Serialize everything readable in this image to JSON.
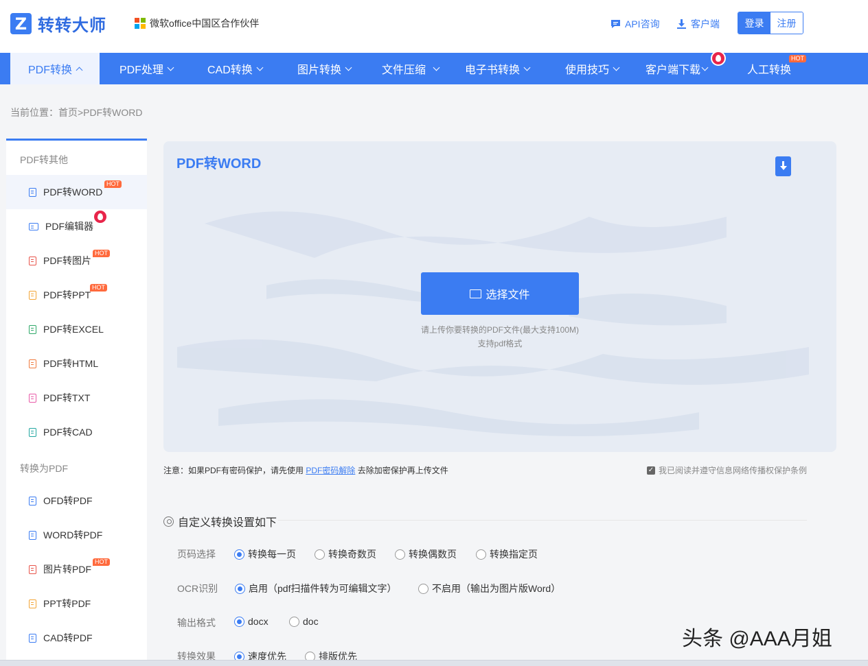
{
  "header": {
    "logo_mark": "Z",
    "logo_text": "转转大师",
    "partner": "微软office中国区合作伙伴",
    "api_link": "API咨询",
    "client_link": "客户端",
    "login": "登录",
    "register": "注册"
  },
  "nav": {
    "items": [
      {
        "label": "PDF转换"
      },
      {
        "label": "PDF处理"
      },
      {
        "label": "CAD转换"
      },
      {
        "label": "图片转换"
      },
      {
        "label": "文件压缩"
      },
      {
        "label": "电子书转换"
      },
      {
        "label": "使用技巧"
      },
      {
        "label": "客户端下载"
      },
      {
        "label": "人工转换"
      }
    ],
    "hot_badge": "HOT"
  },
  "breadcrumb": "当前位置：首页>PDF转WORD",
  "sidebar": {
    "group1": "PDF转其他",
    "group1_items": [
      {
        "label": "PDF转WORD"
      },
      {
        "label": "PDF编辑器"
      },
      {
        "label": "PDF转图片"
      },
      {
        "label": "PDF转PPT"
      },
      {
        "label": "PDF转EXCEL"
      },
      {
        "label": "PDF转HTML"
      },
      {
        "label": "PDF转TXT"
      },
      {
        "label": "PDF转CAD"
      }
    ],
    "group2": "转换为PDF",
    "group2_items": [
      {
        "label": "OFD转PDF"
      },
      {
        "label": "WORD转PDF"
      },
      {
        "label": "图片转PDF"
      },
      {
        "label": "PPT转PDF"
      },
      {
        "label": "CAD转PDF"
      }
    ],
    "hot": "HOT"
  },
  "upload": {
    "title": "PDF转WORD",
    "button": "选择文件",
    "hint1": "请上传你要转换的PDF文件(最大支持100M)",
    "hint2": "支持pdf格式"
  },
  "note": {
    "prefix": "注意：如果PDF有密码保护，请先使用 ",
    "link": "PDF密码解除",
    "suffix": " 去除加密保护再上传文件",
    "agree": "我已阅读并遵守信息网络传播权保护条例"
  },
  "settings": {
    "title": "自定义转换设置如下",
    "page_label": "页码选择",
    "page_opts": [
      "转换每一页",
      "转换奇数页",
      "转换偶数页",
      "转换指定页"
    ],
    "ocr_label": "OCR识别",
    "ocr_opts": [
      "启用（pdf扫描件转为可编辑文字）",
      "不启用（输出为图片版Word）"
    ],
    "format_label": "输出格式",
    "format_opts": [
      "docx",
      "doc"
    ],
    "effect_label": "转换效果",
    "effect_opts": [
      "速度优先",
      "排版优先"
    ]
  },
  "watermark": "头条 @AAA月姐",
  "colors": {
    "accent": "#3b7cf2",
    "hot": "#ff6a3d",
    "fire": "#e8254a"
  }
}
